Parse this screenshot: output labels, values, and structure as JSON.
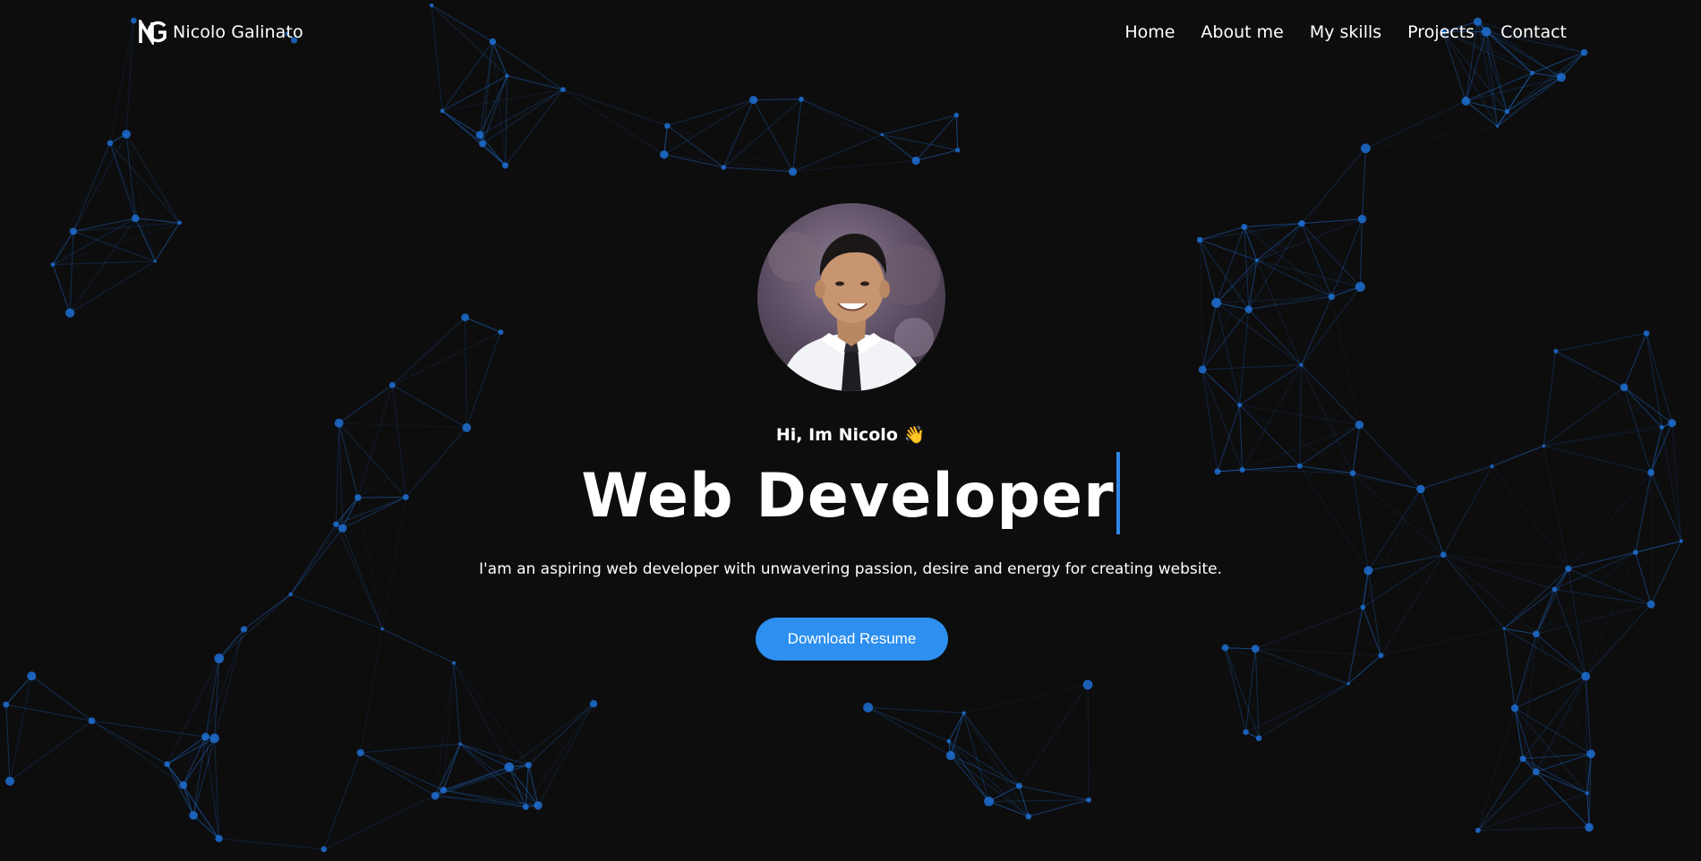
{
  "header": {
    "brand_name": "Nicolo Galinato",
    "logo_icon": "ng-monogram-logo",
    "nav": [
      {
        "label": "Home"
      },
      {
        "label": "About me"
      },
      {
        "label": "My skills"
      },
      {
        "label": "Projects"
      },
      {
        "label": "Contact"
      }
    ]
  },
  "hero": {
    "greeting": "Hi, Im Nicolo 👋",
    "title": "Web Developer",
    "tagline": "I'am an aspiring web developer with unwavering passion, desire and energy for creating website.",
    "button_label": "Download Resume",
    "avatar_icon": "profile-photo"
  },
  "theme": {
    "background": "#0d0d0e",
    "accent": "#2d8ff0",
    "network_color": "#1f6fd1",
    "text": "#ffffff"
  }
}
